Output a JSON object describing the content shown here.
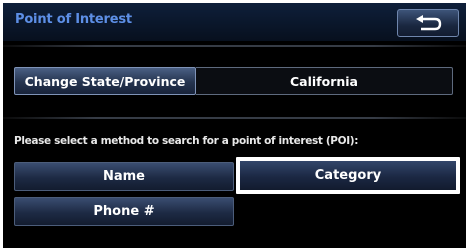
{
  "header": {
    "title": "Point of Interest",
    "back_icon": "return-arrow-icon"
  },
  "state": {
    "button_label": "Change State/Province",
    "current_value": "California"
  },
  "instruction": "Please select a method to search for a point of interest (POI):",
  "options": [
    {
      "label": "Name"
    },
    {
      "label": "Category",
      "selected": true
    },
    {
      "label": "Phone #"
    }
  ],
  "colors": {
    "title": "#5d8fe6",
    "background": "#000000",
    "selection_border": "#ffffff"
  }
}
